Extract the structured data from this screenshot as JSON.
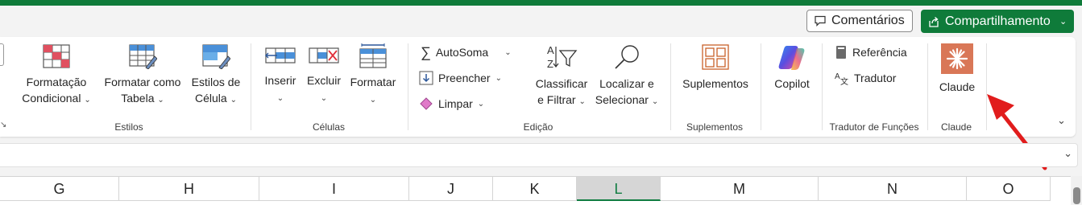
{
  "titlebar": {
    "comments_label": "Comentários",
    "share_label": "Compartilhamento",
    "accent_color": "#0f7b3a"
  },
  "ribbon": {
    "estilos": {
      "label": "Estilos",
      "conditional_line1": "Formatação",
      "conditional_line2": "Condicional",
      "as_table_line1": "Formatar como",
      "as_table_line2": "Tabela",
      "cell_styles_line1": "Estilos de",
      "cell_styles_line2": "Célula"
    },
    "celulas": {
      "label": "Células",
      "insert": "Inserir",
      "delete": "Excluir",
      "format": "Formatar"
    },
    "edicao": {
      "label": "Edição",
      "autosum": "AutoSoma",
      "fill": "Preencher",
      "clear": "Limpar",
      "sort_line1": "Classificar",
      "sort_line2": "e Filtrar",
      "find_line1": "Localizar e",
      "find_line2": "Selecionar"
    },
    "suplementos": {
      "label": "Suplementos",
      "button": "Suplementos"
    },
    "copilot": {
      "button": "Copilot"
    },
    "tradutor": {
      "label": "Tradutor de Funções",
      "reference": "Referência",
      "translator": "Tradutor"
    },
    "claude": {
      "label": "Claude",
      "button": "Claude",
      "color": "#d97757"
    }
  },
  "columns": [
    {
      "name": "G",
      "selected": false
    },
    {
      "name": "H",
      "selected": false
    },
    {
      "name": "I",
      "selected": false
    },
    {
      "name": "J",
      "selected": false
    },
    {
      "name": "K",
      "selected": false
    },
    {
      "name": "L",
      "selected": true
    },
    {
      "name": "M",
      "selected": false
    },
    {
      "name": "N",
      "selected": false
    },
    {
      "name": "O",
      "selected": false
    }
  ],
  "icons": [
    "comment-icon",
    "share-icon",
    "conditional-format-icon",
    "format-table-icon",
    "cell-styles-icon",
    "insert-cells-icon",
    "delete-cells-icon",
    "format-cells-icon",
    "autosum-icon",
    "fill-icon",
    "clear-icon",
    "sort-filter-icon",
    "find-icon",
    "addins-icon",
    "copilot-icon",
    "reference-icon",
    "translator-icon",
    "claude-icon",
    "red-arrow-annotation"
  ]
}
